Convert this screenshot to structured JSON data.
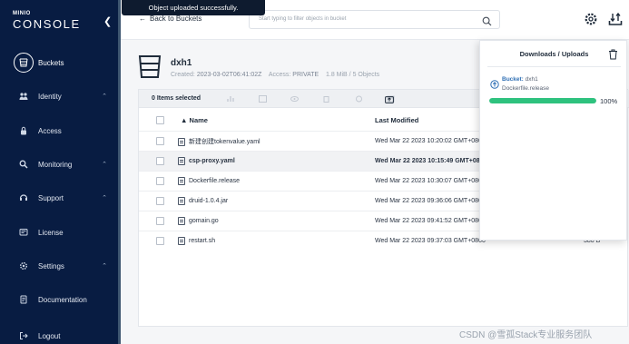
{
  "app": {
    "logo_small": "MINIO",
    "logo_big": "CONSOLE"
  },
  "sidebar": {
    "items": [
      {
        "label": "Buckets",
        "icon": "bucket-icon",
        "active": true
      },
      {
        "label": "Identity",
        "icon": "identity-icon",
        "expandable": true
      },
      {
        "label": "Access",
        "icon": "lock-icon"
      },
      {
        "label": "Monitoring",
        "icon": "magnifier-icon",
        "expandable": true
      },
      {
        "label": "Support",
        "icon": "support-icon",
        "expandable": true
      },
      {
        "label": "License",
        "icon": "license-icon"
      },
      {
        "label": "Settings",
        "icon": "gear-icon",
        "expandable": true
      },
      {
        "label": "Documentation",
        "icon": "document-icon"
      },
      {
        "label": "Logout",
        "icon": "logout-icon"
      }
    ]
  },
  "header": {
    "back_label": "Back to Buckets",
    "search_placeholder": "Start typing to filter objects in bucket",
    "toast": "Object uploaded successfully."
  },
  "bucket": {
    "name": "dxh1",
    "created_label": "Created:",
    "created": "2023-03-02T06:41:02Z",
    "access_label": "Access:",
    "access": "PRIVATE",
    "usage": "1.8 MiB / 5 Objects"
  },
  "table": {
    "selected_label": "0 Items selected",
    "col_name": "Name",
    "col_modified": "Last Modified",
    "rows": [
      {
        "name": "新建创建tokenvalue.yaml",
        "modified": "Wed Mar 22 2023 10:20:02 GMT+0800",
        "size": ""
      },
      {
        "name": "csp-proxy.yaml",
        "modified": "Wed Mar 22 2023 10:15:49 GMT+0800",
        "size": "",
        "highlighted": true
      },
      {
        "name": "Dockerfile.release",
        "modified": "Wed Mar 22 2023 10:30:07 GMT+0800",
        "size": ""
      },
      {
        "name": "druid-1.0.4.jar",
        "modified": "Wed Mar 22 2023 09:36:06 GMT+0800",
        "size": ""
      },
      {
        "name": "gomain.go",
        "modified": "Wed Mar 22 2023 09:41:52 GMT+0800",
        "size": ""
      },
      {
        "name": "restart.sh",
        "modified": "Wed Mar 22 2023 09:37:03 GMT+0800",
        "size": "380 B"
      }
    ]
  },
  "downloads": {
    "title": "Downloads / Uploads",
    "bucket_label": "Bucket:",
    "bucket_name": "dxh1",
    "file": "Dockerfile.release",
    "progress": 1.0,
    "progress_text": "100%"
  },
  "watermark": "CSDN @雪孤Stack专业服务团队",
  "colors": {
    "sidebar_bg": "#081c42",
    "progress": "#2ec27e",
    "toast_bg": "#0e1b2f"
  }
}
